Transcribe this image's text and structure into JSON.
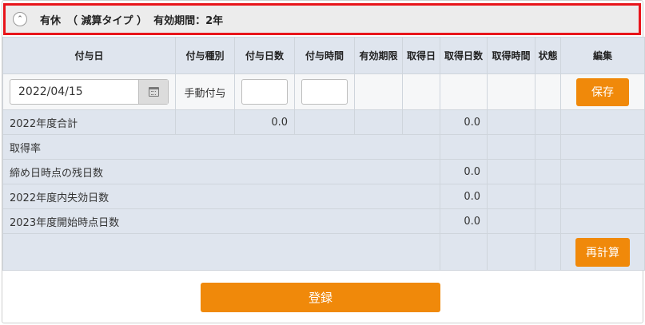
{
  "header": {
    "title_main": "有休",
    "title_type": "（ 減算タイプ ）",
    "title_period": "有効期間：2年"
  },
  "columns": [
    "付与日",
    "付与種別",
    "付与日数",
    "付与時間",
    "有効期限",
    "取得日",
    "取得日数",
    "取得時間",
    "状態",
    "編集"
  ],
  "input_row": {
    "date_value": "2022/04/15",
    "grant_type": "手動付与",
    "save_label": "保存"
  },
  "summary": {
    "total_label": "2022年度合計",
    "total_grant_days": "0.0",
    "total_taken_days": "0.0",
    "rate_label": "取得率",
    "remaining_label": "締め日時点の残日数",
    "remaining_days": "0.0",
    "expired_label": "2022年度内失効日数",
    "expired_days": "0.0",
    "next_start_label": "2023年度開始時点日数",
    "next_start_days": "0.0"
  },
  "recalc_label": "再計算",
  "register_label": "登録"
}
